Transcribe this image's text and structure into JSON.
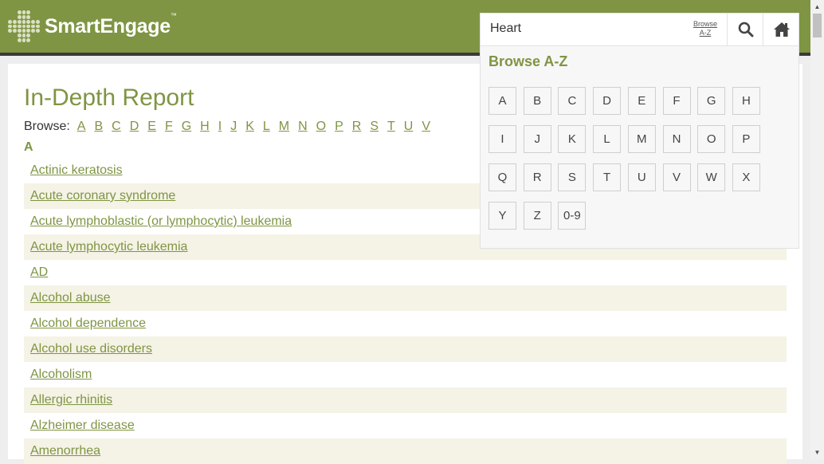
{
  "header": {
    "logo_text": "SmartEngage",
    "logo_tm": "™"
  },
  "page": {
    "title": "In-Depth Report",
    "browse_label": "Browse:",
    "browse_letters": [
      "A",
      "B",
      "C",
      "D",
      "E",
      "F",
      "G",
      "H",
      "I",
      "J",
      "K",
      "L",
      "M",
      "N",
      "O",
      "P",
      "R",
      "S",
      "T",
      "U",
      "V"
    ],
    "section_letter": "A",
    "topics": [
      "Actinic keratosis",
      "Acute coronary syndrome",
      "Acute lymphoblastic (or lymphocytic) leukemia",
      "Acute lymphocytic leukemia",
      "AD",
      "Alcohol abuse",
      "Alcohol dependence",
      "Alcohol use disorders",
      "Alcoholism",
      "Allergic rhinitis",
      "Alzheimer disease",
      "Amenorrhea"
    ]
  },
  "search": {
    "value": "Heart",
    "browse_link_line1": "Browse",
    "browse_link_line2": "A-Z",
    "search_icon": "search-icon",
    "home_icon": "home-icon"
  },
  "browse_panel": {
    "title": "Browse A-Z",
    "letters": [
      "A",
      "B",
      "C",
      "D",
      "E",
      "F",
      "G",
      "H",
      "I",
      "J",
      "K",
      "L",
      "M",
      "N",
      "O",
      "P",
      "Q",
      "R",
      "S",
      "T",
      "U",
      "V",
      "W",
      "X",
      "Y",
      "Z",
      "0-9"
    ]
  },
  "colors": {
    "brand": "#7f9543",
    "stripe": "#f5f2e6"
  }
}
